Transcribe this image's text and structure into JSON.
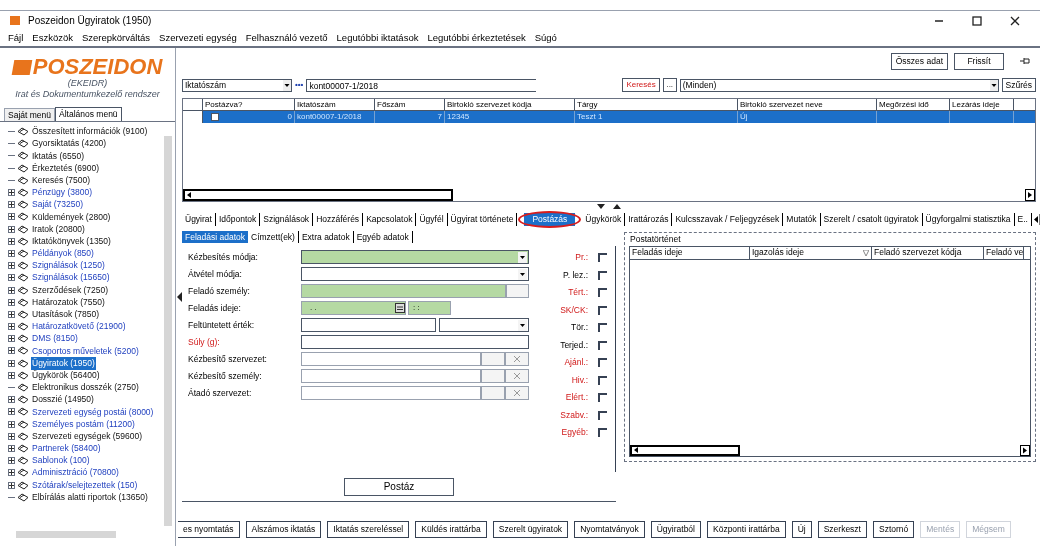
{
  "window": {
    "title": "Poszeidon Ügyiratok (1950)"
  },
  "menu": [
    "Fájl",
    "Eszközök",
    "Szerepkörváltás",
    "Szervezeti egység",
    "Felhasználó vezető",
    "Legutóbbi iktatások",
    "Legutóbbi érkeztetések",
    "Súgó"
  ],
  "logo": {
    "name": "POSZEIDON",
    "subtitle": "(EKEIDR)",
    "tagline": "Irat és Dokumentumkezelő rendszer"
  },
  "side_tabs": [
    {
      "label": "Saját menü",
      "selected": false
    },
    {
      "label": "Általános menü",
      "selected": true
    }
  ],
  "tree": [
    {
      "label": "Összesített információk (9100)",
      "expandable": false,
      "kind": "plain",
      "selected": false
    },
    {
      "label": "Gyorsiktatás (4200)",
      "expandable": false,
      "kind": "plain",
      "selected": false
    },
    {
      "label": "Iktatás (6550)",
      "expandable": false,
      "kind": "plain",
      "selected": false
    },
    {
      "label": "Érkeztetés (6900)",
      "expandable": false,
      "kind": "plain",
      "selected": false
    },
    {
      "label": "Keresés (7500)",
      "expandable": false,
      "kind": "plain",
      "selected": false
    },
    {
      "label": "Pénzügy (3800)",
      "expandable": true,
      "kind": "link",
      "selected": false
    },
    {
      "label": "Saját (73250)",
      "expandable": true,
      "kind": "link",
      "selected": false
    },
    {
      "label": "Küldemények (2800)",
      "expandable": true,
      "kind": "plain",
      "selected": false
    },
    {
      "label": "Iratok (20800)",
      "expandable": true,
      "kind": "plain",
      "selected": false
    },
    {
      "label": "Iktatókönyvek (1350)",
      "expandable": true,
      "kind": "plain",
      "selected": false
    },
    {
      "label": "Példányok (850)",
      "expandable": true,
      "kind": "link",
      "selected": false
    },
    {
      "label": "Szignálások (1250)",
      "expandable": true,
      "kind": "link",
      "selected": false
    },
    {
      "label": "Szignálások (15650)",
      "expandable": true,
      "kind": "link",
      "selected": false
    },
    {
      "label": "Szerződések (7250)",
      "expandable": true,
      "kind": "plain",
      "selected": false
    },
    {
      "label": "Határozatok (7550)",
      "expandable": true,
      "kind": "plain",
      "selected": false
    },
    {
      "label": "Utasítások (7850)",
      "expandable": true,
      "kind": "plain",
      "selected": false
    },
    {
      "label": "Határozatkövető (21900)",
      "expandable": true,
      "kind": "link",
      "selected": false
    },
    {
      "label": "DMS (8150)",
      "expandable": true,
      "kind": "link",
      "selected": false
    },
    {
      "label": "Csoportos műveletek (5200)",
      "expandable": true,
      "kind": "link",
      "selected": false
    },
    {
      "label": "Ügyiratok (1950)",
      "expandable": true,
      "kind": "link",
      "selected": true
    },
    {
      "label": "Ügykörök (56400)",
      "expandable": true,
      "kind": "plain",
      "selected": false
    },
    {
      "label": "Elektronikus dosszék (2750)",
      "expandable": false,
      "kind": "plain",
      "selected": false
    },
    {
      "label": "Dosszié (14950)",
      "expandable": true,
      "kind": "plain",
      "selected": false
    },
    {
      "label": "Szervezeti egység postái (8000)",
      "expandable": true,
      "kind": "link",
      "selected": false
    },
    {
      "label": "Személyes postám (11200)",
      "expandable": true,
      "kind": "link",
      "selected": false
    },
    {
      "label": "Szervezeti egységek (59600)",
      "expandable": true,
      "kind": "plain",
      "selected": false
    },
    {
      "label": "Partnerek (58400)",
      "expandable": true,
      "kind": "link",
      "selected": false
    },
    {
      "label": "Sablonok (100)",
      "expandable": true,
      "kind": "link",
      "selected": false
    },
    {
      "label": "Adminisztráció (70800)",
      "expandable": true,
      "kind": "link",
      "selected": false
    },
    {
      "label": "Szótárak/selejtezettek (150)",
      "expandable": true,
      "kind": "link",
      "selected": false
    },
    {
      "label": "Elbírálás alatti riportok (13650)",
      "expandable": false,
      "kind": "plain",
      "selected": false
    }
  ],
  "toolbar": {
    "buttons": [
      "Összes adat",
      "Frissít"
    ]
  },
  "search": {
    "field_type": "Iktatószám",
    "more": "•••",
    "value": "kont00007-1/2018",
    "search_button": "Keresés",
    "dots_button": "...",
    "filter": "(Minden)",
    "filter_button": "Szűrés"
  },
  "table": {
    "columns": [
      "Postázva?",
      "Iktatószám",
      "Főszám",
      "Birtokló szervezet kódja",
      "Tárgy",
      "Birtokló szervezet neve",
      "Megőrzési idő",
      "Lezárás ideje"
    ],
    "rows": [
      {
        "selected": true,
        "cells": [
          "0",
          "kont00007-1/2018",
          "7",
          "12345",
          "Teszt 1",
          "Új",
          "",
          ""
        ]
      }
    ]
  },
  "tabs": [
    {
      "label": "Ügyirat",
      "selected": false
    },
    {
      "label": "Időpontok",
      "selected": false
    },
    {
      "label": "Szignálások",
      "selected": false
    },
    {
      "label": "Hozzáférés",
      "selected": false
    },
    {
      "label": "Kapcsolatok",
      "selected": false
    },
    {
      "label": "Ügyfél",
      "selected": false
    },
    {
      "label": "Ügyirat története",
      "selected": false
    },
    {
      "label": "Postázás",
      "selected": true
    },
    {
      "label": "Ügykörök",
      "selected": false
    },
    {
      "label": "Irattározás",
      "selected": false
    },
    {
      "label": "Kulcsszavak / Feljegyzések",
      "selected": false
    },
    {
      "label": "Mutatók",
      "selected": false
    },
    {
      "label": "Szerelt / csatolt ügyiratok",
      "selected": false
    },
    {
      "label": "Ügyforgalmi statisztika",
      "selected": false
    },
    {
      "label": "E..",
      "selected": false
    }
  ],
  "subtabs": [
    {
      "label": "Feladási adatok",
      "selected": true
    },
    {
      "label": "Címzett(ek)",
      "selected": false
    },
    {
      "label": "Extra adatok",
      "selected": false
    },
    {
      "label": "Egyéb adatok",
      "selected": false
    }
  ],
  "form": [
    {
      "label": "Kézbesítés módja:",
      "kind": "combo",
      "required": true,
      "label_red": false
    },
    {
      "label": "Átvétel módja:",
      "kind": "combo",
      "required": false,
      "label_red": false
    },
    {
      "label": "Feladó személy:",
      "kind": "picker",
      "required": true,
      "label_red": false
    },
    {
      "label": "Feladás ideje:",
      "kind": "datetime",
      "required": true,
      "label_red": false,
      "date": ". .",
      "time": ": :"
    },
    {
      "label": "Feltüntetett érték:",
      "kind": "textcombo",
      "required": false,
      "label_red": false
    },
    {
      "label": "Súly (g):",
      "kind": "text",
      "required": false,
      "label_red": true
    },
    {
      "label": "Kézbesítő szervezet:",
      "kind": "lookup",
      "required": false,
      "label_red": false
    },
    {
      "label": "Kézbesítő személy:",
      "kind": "lookup",
      "required": false,
      "label_red": false
    },
    {
      "label": "Átadó szervezet:",
      "kind": "lookup",
      "required": false,
      "label_red": false
    }
  ],
  "flags": [
    {
      "label": "Pr.:",
      "red": true,
      "checked": false
    },
    {
      "label": "P. lez.:",
      "red": false,
      "checked": false
    },
    {
      "label": "Tért.:",
      "red": true,
      "checked": false
    },
    {
      "label": "SK/CK:",
      "red": true,
      "checked": false
    },
    {
      "label": "Tör.:",
      "red": false,
      "checked": false
    },
    {
      "label": "Terjed.:",
      "red": false,
      "checked": false
    },
    {
      "label": "Ajánl.:",
      "red": true,
      "checked": false
    },
    {
      "label": "Hiv.:",
      "red": true,
      "checked": false
    },
    {
      "label": "Elért.:",
      "red": true,
      "checked": false
    },
    {
      "label": "Szabv.:",
      "red": true,
      "checked": false
    },
    {
      "label": "Egyéb:",
      "red": true,
      "checked": false
    }
  ],
  "history": {
    "title": "Postatörténet",
    "columns": [
      "Feladás ideje",
      "Igazolás ideje",
      "Feladó szervezet kódja",
      "Feladó ve"
    ]
  },
  "post_button": "Postáz",
  "actions": [
    {
      "label": "es nyomtatás",
      "disabled": false
    },
    {
      "label": "Alszámos iktatás",
      "disabled": false
    },
    {
      "label": "Iktatás szereléssel",
      "disabled": false
    },
    {
      "label": "Küldés irattárba",
      "disabled": false
    },
    {
      "label": "Szerelt ügyiratok",
      "disabled": false
    },
    {
      "label": "Nyomtatványok",
      "disabled": false
    },
    {
      "label": "Ügyiratból",
      "disabled": false
    },
    {
      "label": "Központi irattárba",
      "disabled": false
    },
    {
      "label": "Új",
      "disabled": false
    },
    {
      "label": "Szerkeszt",
      "disabled": false
    },
    {
      "label": "Sztornó",
      "disabled": false
    },
    {
      "label": "Mentés",
      "disabled": true
    },
    {
      "label": "Mégsem",
      "disabled": true
    }
  ]
}
